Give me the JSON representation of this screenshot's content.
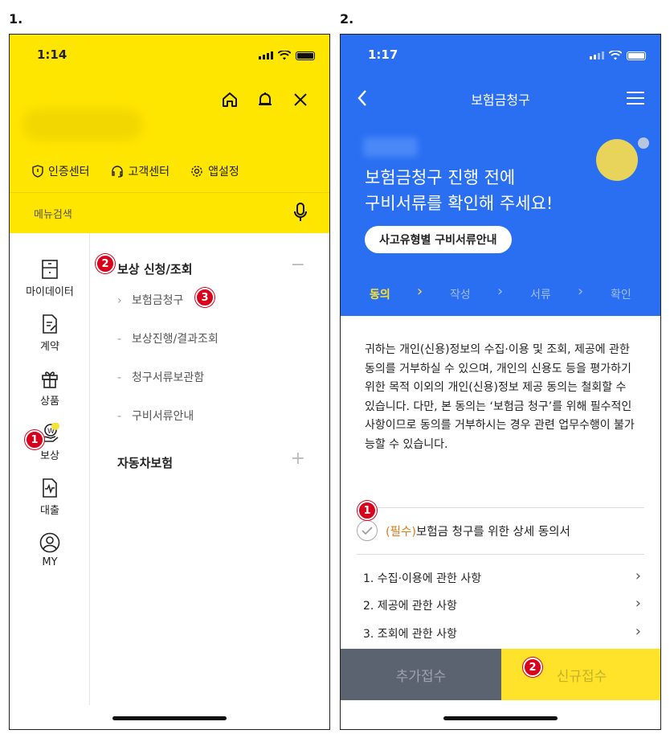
{
  "labels": {
    "step1": "1.",
    "step2": "2."
  },
  "screen1": {
    "time": "1:14",
    "links": [
      "인증센터",
      "고객센터",
      "앱설정"
    ],
    "search_placeholder": "메뉴검색",
    "sidebar": [
      {
        "label": "마이데이터",
        "icon": "drawer-icon"
      },
      {
        "label": "계약",
        "icon": "contract-icon"
      },
      {
        "label": "상품",
        "icon": "gift-icon"
      },
      {
        "label": "보상",
        "icon": "compensation-icon"
      },
      {
        "label": "대출",
        "icon": "loan-icon"
      },
      {
        "label": "MY",
        "icon": "user-icon"
      }
    ],
    "menu": {
      "section1": "보상 신청/조회",
      "section1_sign": "−",
      "items": [
        "보험금청구",
        "보상진행/결과조회",
        "청구서류보관함",
        "구비서류안내"
      ],
      "section2": "자동차보험",
      "section2_sign": "+"
    },
    "markers": [
      "1",
      "2",
      "3"
    ]
  },
  "screen2": {
    "time": "1:17",
    "title": "보험금청구",
    "hero_line1": "보험금청구 진행 전에",
    "hero_line2": "구비서류를 확인해 주세요!",
    "guide_button": "사고유형별 구비서류안내",
    "steps": [
      "동의",
      "작성",
      "서류",
      "확인"
    ],
    "step_sep": "›",
    "consent_text": "귀하는 개인(신용)정보의 수집·이용 및 조회, 제공에 관한 동의를 거부하실 수 있으며, 개인의 신용도 등을 평가하기 위한 목적 이외의 개인(신용)정보 제공 동의는 철회할 수 있습니다. 다만, 본 동의는 ‘보험금 청구’를 위해 필수적인 사항이므로 동의를 거부하시는 경우 관련 업무수행이 불가능할 수 있습니다.",
    "required_prefix": "(필수)",
    "required_label": "보험금 청구를 위한 상세 동의서",
    "sub_items": [
      "1. 수집·이용에 관한 사항",
      "2. 제공에 관한 사항",
      "3. 조회에 관한 사항"
    ],
    "chevron": "›",
    "btn_additional": "추가접수",
    "btn_new": "신규접수",
    "markers": [
      "1",
      "2"
    ]
  },
  "colors": {
    "yellow": "#ffe600",
    "blue": "#2a6ff2",
    "marker": "#d9001b",
    "orange": "#e07b1a"
  }
}
